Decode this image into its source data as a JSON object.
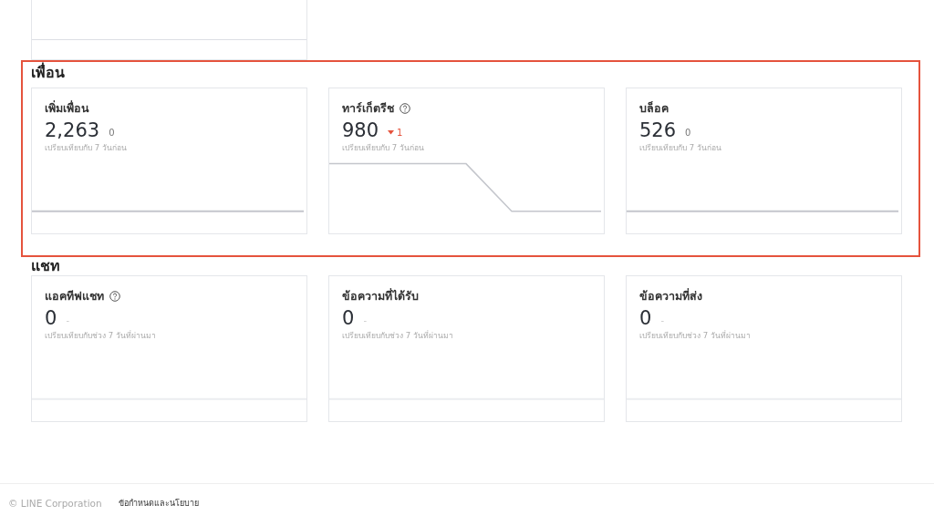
{
  "sections": [
    {
      "title": "เพื่อน",
      "highlighted": true,
      "cards": [
        {
          "title": "เพิ่มเพื่อน",
          "help": false,
          "value": "2,263",
          "change": "0",
          "kind": "flat",
          "note": "เปรียบเทียบกับ 7 วันก่อน"
        },
        {
          "title": "ทาร์เก็ตรีช",
          "help": true,
          "value": "980",
          "change": "1",
          "kind": "down",
          "note": "เปรียบเทียบกับ 7 วันก่อน"
        },
        {
          "title": "บล็อค",
          "help": false,
          "value": "526",
          "change": "0",
          "kind": "flat",
          "note": "เปรียบเทียบกับ 7 วันก่อน"
        }
      ]
    },
    {
      "title": "แชท",
      "highlighted": false,
      "cards": [
        {
          "title": "แอคทีฟแชท",
          "help": true,
          "value": "0",
          "change": "-",
          "kind": "none",
          "note": "เปรียบเทียบกับช่วง 7 วันที่ผ่านมา"
        },
        {
          "title": "ข้อความที่ได้รับ",
          "help": false,
          "value": "0",
          "change": "-",
          "kind": "none",
          "note": "เปรียบเทียบกับช่วง 7 วันที่ผ่านมา"
        },
        {
          "title": "ข้อความที่ส่ง",
          "help": false,
          "value": "0",
          "change": "-",
          "kind": "none",
          "note": "เปรียบเทียบกับช่วง 7 วันที่ผ่านมา"
        }
      ]
    }
  ],
  "footer": {
    "copyright": "© LINE Corporation",
    "link": "ข้อกำหนดและนโยบาย"
  }
}
